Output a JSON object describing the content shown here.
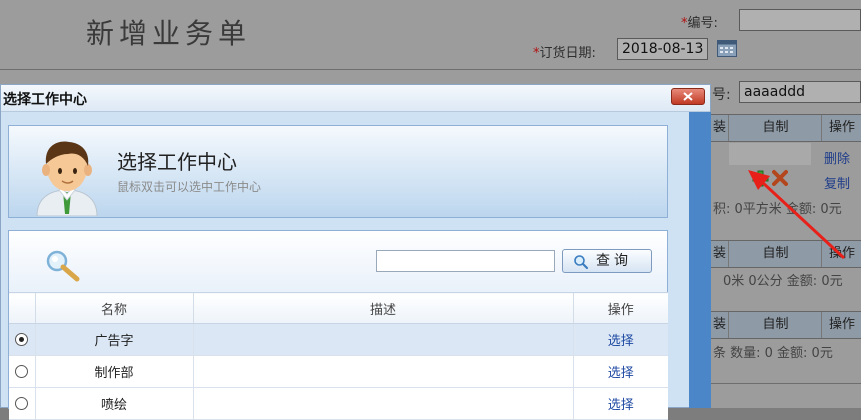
{
  "page": {
    "title": "新增业务单",
    "required_mark": "*",
    "number_label": "编号:",
    "order_date_label": "订货日期:",
    "order_date_value": "2018-08-13",
    "field_label_partial": "号:",
    "field_value": "aaaaddd"
  },
  "tables": [
    {
      "col_partial": "装",
      "col_homemade": "自制",
      "col_action": "操作",
      "links": [
        "删除",
        "复制"
      ],
      "summary": "积: 0平方米 金额: 0元"
    },
    {
      "col_partial": "装",
      "col_homemade": "自制",
      "col_action": "操作",
      "summary": "0米 0公分 金额: 0元"
    },
    {
      "col_partial": "装",
      "col_homemade": "自制",
      "col_action": "操作",
      "summary": "条 数量: 0 金额: 0元"
    }
  ],
  "dialog": {
    "title": "选择工作中心",
    "header_title": "选择工作中心",
    "header_subtitle": "鼠标双击可以选中工作中心",
    "search_placeholder": "",
    "search_button": "查询",
    "columns": [
      "名称",
      "描述",
      "操作"
    ],
    "rows": [
      {
        "name": "广告字",
        "description": "",
        "action": "选择",
        "selected": true
      },
      {
        "name": "制作部",
        "description": "",
        "action": "选择",
        "selected": false
      },
      {
        "name": "喷绘",
        "description": "",
        "action": "选择",
        "selected": false
      }
    ]
  },
  "colors": {
    "annotation_arrow": "#e8201a",
    "dialog_blue": "#4a86c8",
    "link_blue": "#1f4aa3"
  }
}
